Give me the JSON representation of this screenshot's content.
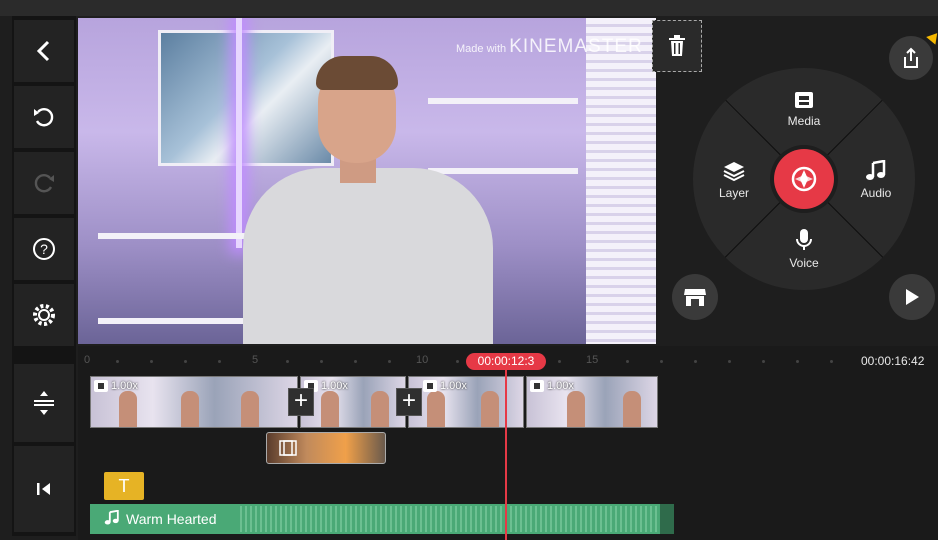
{
  "app": {
    "name": "KineMaster"
  },
  "preview": {
    "watermark_prefix": "Made with",
    "watermark_brand": "KINEMASTER"
  },
  "wheel": {
    "media_label": "Media",
    "layer_label": "Layer",
    "audio_label": "Audio",
    "voice_label": "Voice"
  },
  "timeline": {
    "ruler_marks": [
      "0",
      "5",
      "10",
      "15"
    ],
    "current_time": "00:00:12:3",
    "total_time": "00:00:16:42",
    "clips": [
      {
        "speed": "1.00x"
      },
      {
        "speed": "1.00x"
      },
      {
        "speed": "1.00x"
      },
      {
        "speed": "1.00x"
      }
    ],
    "text_layer_label": "T",
    "audio_track": {
      "name": "Warm Hearted"
    }
  },
  "colors": {
    "accent": "#e63946",
    "audio": "#4aa976",
    "text_layer": "#e6b325"
  },
  "icons": [
    "back-icon",
    "undo-icon",
    "redo-icon",
    "help-icon",
    "settings-icon",
    "timeline-expand-icon",
    "jump-to-start-icon",
    "trash-icon",
    "share-icon",
    "store-icon",
    "play-icon",
    "record-icon"
  ]
}
